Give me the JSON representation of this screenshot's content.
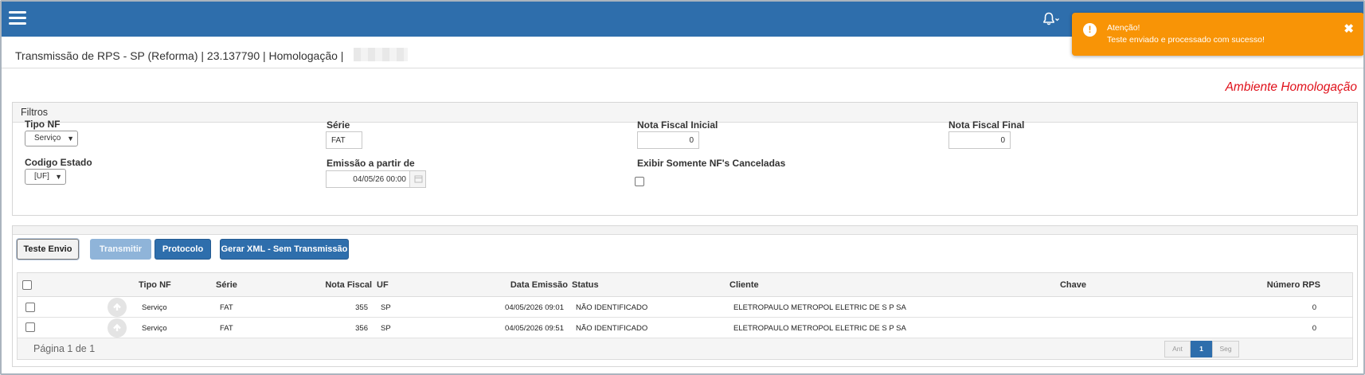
{
  "header": {
    "title": "Transmissão de RPS - SP (Reforma) | 23.137790 | Homologação |",
    "ambiente": "Ambiente Homologação"
  },
  "toast": {
    "icon": "!",
    "title": "Atenção!",
    "message": "Teste enviado e processado com sucesso!",
    "close": "✖"
  },
  "filters": {
    "heading": "Filtros",
    "tipo_nf": {
      "label": "Tipo NF",
      "value": "Serviço"
    },
    "serie": {
      "label": "Série",
      "value": "FAT"
    },
    "nota_inicial": {
      "label": "Nota Fiscal Inicial",
      "value": "0"
    },
    "nota_final": {
      "label": "Nota Fiscal Final",
      "value": "0"
    },
    "codigo_estado": {
      "label": "Codigo Estado",
      "value": "[UF]"
    },
    "emissao": {
      "label": "Emissão a partir de",
      "value": "04/05/26 00:00"
    },
    "canceladas": {
      "label": "Exibir Somente NF's Canceladas",
      "checked": false
    }
  },
  "actions": {
    "teste_envio": "Teste Envio",
    "transmitir": "Transmitir",
    "protocolo": "Protocolo",
    "gerar_xml": "Gerar XML - Sem Transmissão"
  },
  "grid": {
    "columns": {
      "tipo_nf": "Tipo NF",
      "serie": "Série",
      "nota_fiscal": "Nota Fiscal",
      "uf": "UF",
      "data_emissao": "Data Emissão",
      "status": "Status",
      "cliente": "Cliente",
      "chave": "Chave",
      "numero_rps": "Número RPS"
    },
    "rows": [
      {
        "tipo_nf": "Serviço",
        "serie": "FAT",
        "nota_fiscal": "355",
        "uf": "SP",
        "data_emissao": "04/05/2026 09:01",
        "status": "NÃO IDENTIFICADO",
        "cliente": "ELETROPAULO METROPOL ELETRIC DE S P SA",
        "chave": "",
        "numero_rps": "0"
      },
      {
        "tipo_nf": "Serviço",
        "serie": "FAT",
        "nota_fiscal": "356",
        "uf": "SP",
        "data_emissao": "04/05/2026 09:51",
        "status": "NÃO IDENTIFICADO",
        "cliente": "ELETROPAULO METROPOL ELETRIC DE S P SA",
        "chave": "",
        "numero_rps": "0"
      }
    ],
    "pagination": {
      "text": "Página 1 de 1",
      "prev": "Ant",
      "current": "1",
      "next": "Seg"
    }
  },
  "colors": {
    "topbar": "#2e6eac",
    "toast": "#f89406",
    "ambiente": "#e0101a"
  }
}
